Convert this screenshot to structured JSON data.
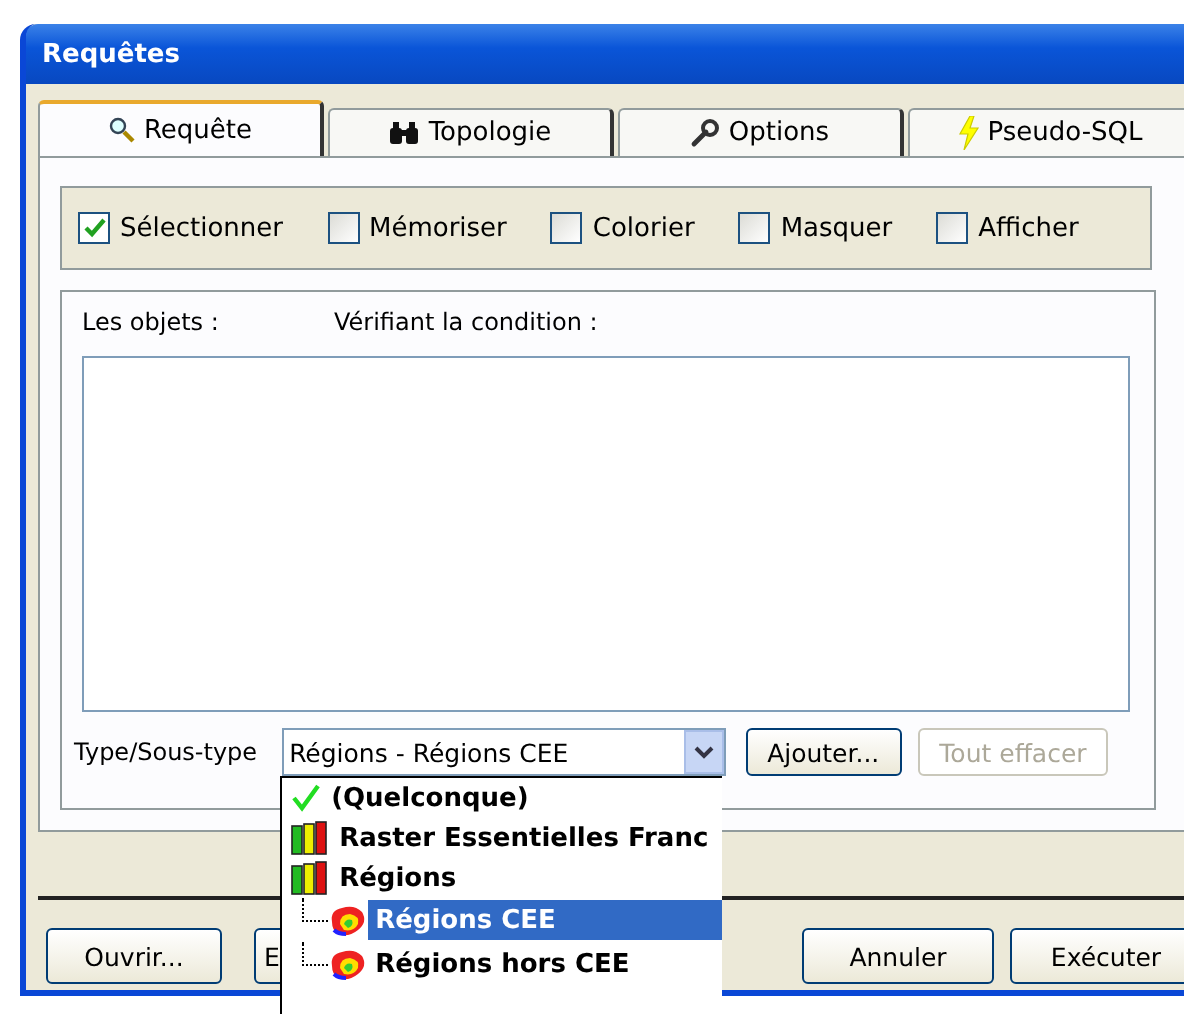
{
  "window": {
    "title": "Requêtes"
  },
  "tabs": [
    {
      "label": "Requête",
      "kind": "magnifier",
      "selected": true
    },
    {
      "label": "Topologie",
      "kind": "binoculars",
      "selected": false
    },
    {
      "label": "Options",
      "kind": "wrench",
      "selected": false
    },
    {
      "label": "Pseudo-SQL",
      "kind": "lightning",
      "selected": false
    }
  ],
  "options": [
    {
      "label": "Sélectionner",
      "checked": true
    },
    {
      "label": "Mémoriser",
      "checked": false
    },
    {
      "label": "Colorier",
      "checked": false
    },
    {
      "label": "Masquer",
      "checked": false
    },
    {
      "label": "Afficher",
      "checked": false
    }
  ],
  "condition": {
    "column_1": "Les objets :",
    "column_2": "Vérifiant la condition :"
  },
  "type_row": {
    "label": "Type/Sous-type",
    "value": "Régions - Régions CEE",
    "buttons": [
      {
        "label": "Ajouter...",
        "disabled": false
      },
      {
        "label": "Tout effacer",
        "disabled": true
      }
    ]
  },
  "dropdown": [
    {
      "label": "(Quelconque)",
      "kind": "check",
      "selected": false
    },
    {
      "label": "Raster Essentielles Franc",
      "kind": "books",
      "selected": false
    },
    {
      "label": "Régions",
      "kind": "books",
      "selected": false,
      "children": [
        {
          "label": "Régions CEE",
          "kind": "map",
          "selected": true
        },
        {
          "label": "Régions hors CEE",
          "kind": "map",
          "selected": false
        }
      ]
    }
  ],
  "footer_left": [
    "Ouvrir...",
    "E"
  ],
  "footer_right": [
    "Annuler",
    "Exécuter"
  ]
}
